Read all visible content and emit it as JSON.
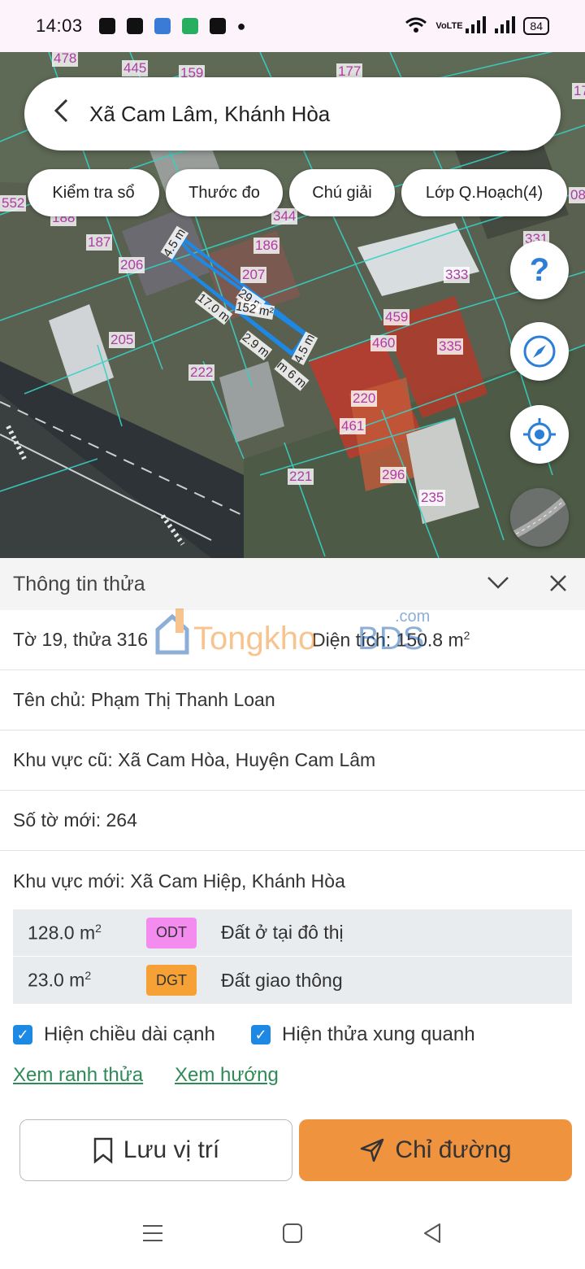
{
  "status_bar": {
    "time": "14:03",
    "network": "VoLTE",
    "battery": "84"
  },
  "search": {
    "title": "Xã Cam Lâm, Khánh Hòa"
  },
  "chips": [
    {
      "label": "Kiểm tra sổ"
    },
    {
      "label": "Thước đo"
    },
    {
      "label": "Chú giải"
    },
    {
      "label": "Lớp Q.Hoạch(4)"
    }
  ],
  "map": {
    "parcel_labels": [
      "478",
      "445",
      "159",
      "177",
      "552",
      "188",
      "187",
      "186",
      "206",
      "207",
      "344",
      "333",
      "331",
      "205",
      "222",
      "459",
      "460",
      "335",
      "220",
      "461",
      "221",
      "296",
      "235",
      "17",
      "08"
    ],
    "measurements": {
      "side_top": "4.5 m",
      "side_right": "4.5 m",
      "length_top": "29 m",
      "area": "152 m²",
      "length_left": "17.0 m",
      "length_bottom": "2.9 m",
      "length_bottom2": "m 6 m"
    },
    "colors": {
      "parcel_outline": "#1e88e5",
      "label_text": "#b03aa8",
      "grid": "#37d0c4"
    }
  },
  "sheet": {
    "title": "Thông tin thửa",
    "to_thua": "Tờ 19, thửa 316",
    "dien_tich_label": "Diện tích:",
    "dien_tich_value": "150.8 m",
    "ten_chu": "Tên chủ: Phạm Thị Thanh Loan",
    "khu_vuc_cu": "Khu vực cũ: Xã Cam Hòa, Huyện Cam Lâm",
    "so_to_moi": "Số tờ mới: 264",
    "khu_vuc_moi": "Khu vực mới: Xã Cam Hiệp, Khánh Hòa",
    "land_use": [
      {
        "area": "128.0 m",
        "code": "ODT",
        "desc": "Đất ở tại đô thị",
        "color": "#f48cf0"
      },
      {
        "area": "23.0 m",
        "code": "DGT",
        "desc": "Đất giao thông",
        "color": "#f5a135"
      }
    ],
    "checkbox_edges": "Hiện chiều dài cạnh",
    "checkbox_neighbors": "Hiện thửa xung quanh",
    "link_boundary": "Xem ranh thửa",
    "link_direction": "Xem hướng",
    "save_label": "Lưu vị trí",
    "route_label": "Chỉ đường"
  },
  "watermark": {
    "text": "TongkhoBDS",
    "suffix": ".com"
  }
}
